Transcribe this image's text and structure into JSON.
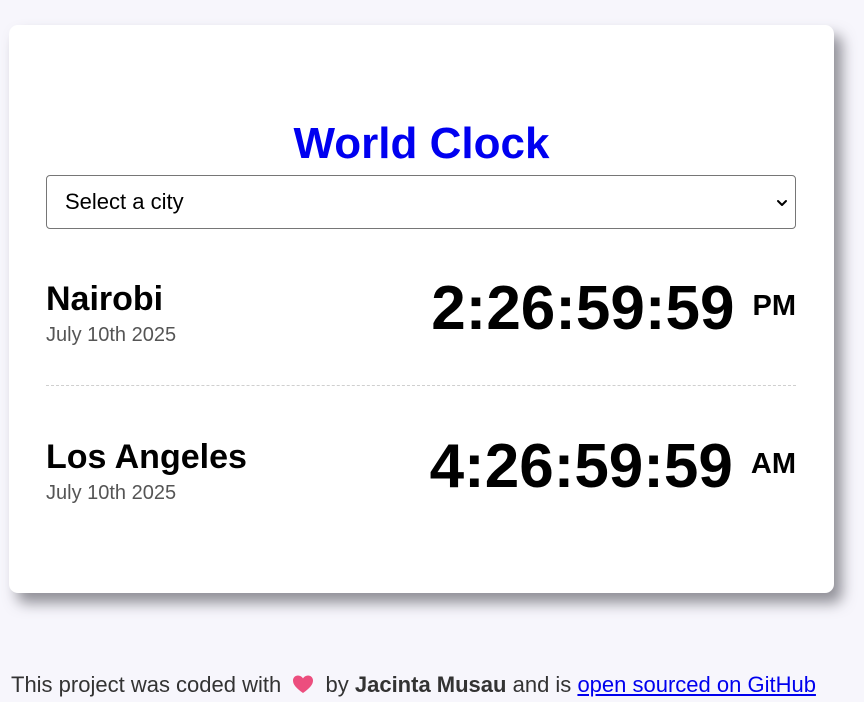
{
  "app": {
    "title": "World Clock"
  },
  "city_select": {
    "selected": "Select a city",
    "icon": "chevron-down-icon"
  },
  "cities": [
    {
      "name": "Nairobi",
      "date": "July 10th 2025",
      "time": "2:26:59:59",
      "period": "PM"
    },
    {
      "name": "Los Angeles",
      "date": "July 10th 2025",
      "time": "4:26:59:59",
      "period": "AM"
    }
  ],
  "footer": {
    "prefix": "This project was coded with",
    "heart_icon": "heart-icon",
    "by": "by",
    "author": "Jacinta Musau",
    "middle": "and is",
    "link_text": "open sourced on GitHub"
  },
  "colors": {
    "title": "#0000f0",
    "background": "#f7f6fc",
    "card": "#ffffff",
    "link": "#0000ee",
    "heart": "#ec4e7e"
  }
}
